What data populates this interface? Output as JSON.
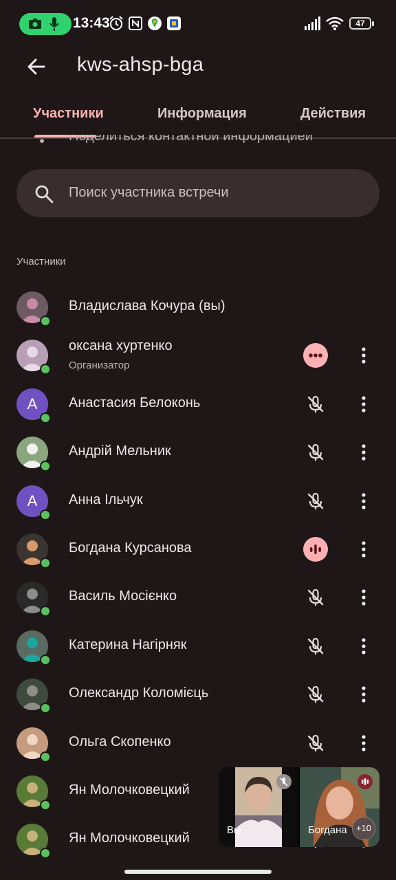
{
  "status_bar": {
    "time": "13:43",
    "battery": "47"
  },
  "app_bar": {
    "title": "kws-ahsp-bga"
  },
  "tabs": [
    {
      "label": "Участники"
    },
    {
      "label": "Информация"
    },
    {
      "label": "Действия"
    }
  ],
  "clipped_text": "Поделиться контактной информацией",
  "search": {
    "placeholder": "Поиск участника встречи"
  },
  "section_label": "Участники",
  "participants": [
    {
      "name": "Владислава Кочура (вы)",
      "subtitle": "",
      "avatar_letter": "",
      "status": "none"
    },
    {
      "name": "оксана хуртенко",
      "subtitle": "Организатор",
      "avatar_letter": "",
      "status": "more-dots"
    },
    {
      "name": "Анастасия Белоконь",
      "subtitle": "",
      "avatar_letter": "А",
      "status": "muted"
    },
    {
      "name": "Андрій Мельник",
      "subtitle": "",
      "avatar_letter": "",
      "status": "muted"
    },
    {
      "name": "Анна Ільчук",
      "subtitle": "",
      "avatar_letter": "А",
      "status": "muted"
    },
    {
      "name": "Богдана Курсанова",
      "subtitle": "",
      "avatar_letter": "",
      "status": "speaking"
    },
    {
      "name": "Василь Мосієнко",
      "subtitle": "",
      "avatar_letter": "",
      "status": "muted"
    },
    {
      "name": "Катерина Нагірняк",
      "subtitle": "",
      "avatar_letter": "",
      "status": "muted"
    },
    {
      "name": "Олександр Коломієць",
      "subtitle": "",
      "avatar_letter": "",
      "status": "muted"
    },
    {
      "name": "Ольга Скопенко",
      "subtitle": "",
      "avatar_letter": "",
      "status": "muted"
    },
    {
      "name": "Ян Молочковецкий",
      "subtitle": "",
      "avatar_letter": "",
      "status": "muted"
    },
    {
      "name": "Ян Молочковецкий",
      "subtitle": "",
      "avatar_letter": "",
      "status": "muted"
    }
  ],
  "pip": {
    "self_label": "Вы",
    "other_label": "Богдана",
    "extra_count": "+10"
  },
  "colors": {
    "background": "#1f1717",
    "accent": "#ffb3b3",
    "presence": "#59c15f",
    "avatar_letter_bg": "#7051c2"
  }
}
